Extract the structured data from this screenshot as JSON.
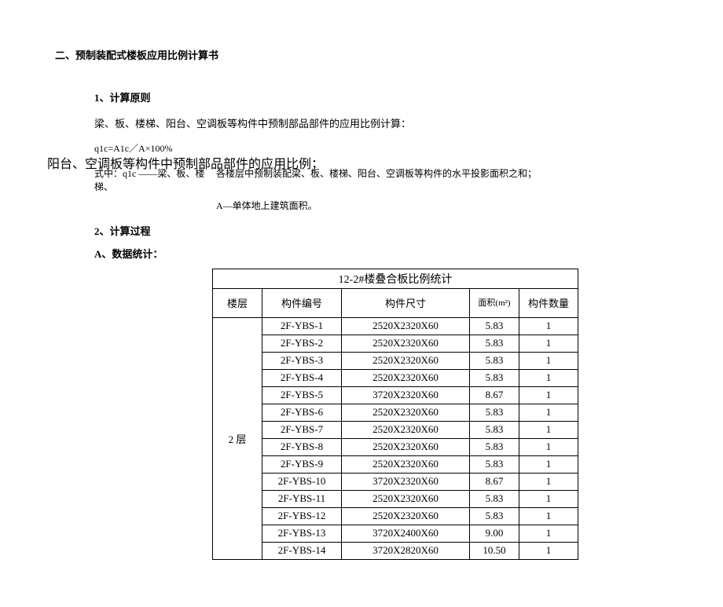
{
  "title": "二、预制装配式楼板应用比例计算书",
  "section1": {
    "heading": "1、计算原则",
    "para1": "梁、板、楼梯、阳台、空调板等构件中预制部品部件的应用比例计算：",
    "formula": "q1c=A1c／A×100%",
    "overlay": "阳台、空调板等构件中预制部品部件的应用比例；",
    "def_left_l1": "式中：q1c ——梁、板、楼",
    "def_left_l2": "梯、",
    "def_right_l1": "各楼层中预制装配梁、板、楼梯、阳台、空调板等构件的水平投影面积之和；",
    "def_a": "A—单体地上建筑面积。"
  },
  "section2": {
    "heading": "2、计算过程",
    "sub": "A、数据统计："
  },
  "table": {
    "title": "12-2#楼叠合板比例统计",
    "headers": {
      "floor": "楼层",
      "code": "构件编号",
      "size": "构件尺寸",
      "area": "面积(m²)",
      "qty": "构件数量"
    },
    "floor_label": "2 层",
    "rows": [
      {
        "code": "2F-YBS-1",
        "size": "2520X2320X60",
        "area": "5.83",
        "qty": "1"
      },
      {
        "code": "2F-YBS-2",
        "size": "2520X2320X60",
        "area": "5.83",
        "qty": "1"
      },
      {
        "code": "2F-YBS-3",
        "size": "2520X2320X60",
        "area": "5.83",
        "qty": "1"
      },
      {
        "code": "2F-YBS-4",
        "size": "2520X2320X60",
        "area": "5.83",
        "qty": "1"
      },
      {
        "code": "2F-YBS-5",
        "size": "3720X2320X60",
        "area": "8.67",
        "qty": "1"
      },
      {
        "code": "2F-YBS-6",
        "size": "2520X2320X60",
        "area": "5.83",
        "qty": "1"
      },
      {
        "code": "2F-YBS-7",
        "size": "2520X2320X60",
        "area": "5.83",
        "qty": "1"
      },
      {
        "code": "2F-YBS-8",
        "size": "2520X2320X60",
        "area": "5.83",
        "qty": "1"
      },
      {
        "code": "2F-YBS-9",
        "size": "2520X2320X60",
        "area": "5.83",
        "qty": "1"
      },
      {
        "code": "2F-YBS-10",
        "size": "3720X2320X60",
        "area": "8.67",
        "qty": "1"
      },
      {
        "code": "2F-YBS-11",
        "size": "2520X2320X60",
        "area": "5.83",
        "qty": "1"
      },
      {
        "code": "2F-YBS-12",
        "size": "2520X2320X60",
        "area": "5.83",
        "qty": "1"
      },
      {
        "code": "2F-YBS-13",
        "size": "3720X2400X60",
        "area": "9.00",
        "qty": "1"
      },
      {
        "code": "2F-YBS-14",
        "size": "3720X2820X60",
        "area": "10.50",
        "qty": "1"
      }
    ]
  }
}
